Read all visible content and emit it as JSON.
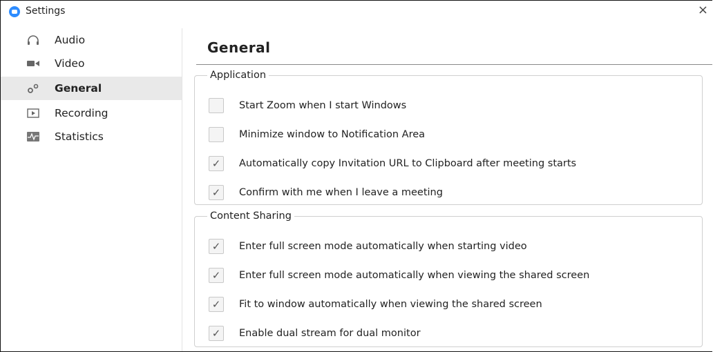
{
  "window": {
    "title": "Settings",
    "close_glyph": "×"
  },
  "sidebar": {
    "items": [
      {
        "label": "Audio",
        "icon": "headphones-icon",
        "active": false
      },
      {
        "label": "Video",
        "icon": "video-camera-icon",
        "active": false
      },
      {
        "label": "General",
        "icon": "gears-icon",
        "active": true
      },
      {
        "label": "Recording",
        "icon": "recording-icon",
        "active": false
      },
      {
        "label": "Statistics",
        "icon": "statistics-icon",
        "active": false
      }
    ]
  },
  "main": {
    "heading": "General",
    "groups": [
      {
        "legend": "Application",
        "options": [
          {
            "label": "Start Zoom when I start Windows",
            "checked": false
          },
          {
            "label": "Minimize window to Notification Area",
            "checked": false
          },
          {
            "label": "Automatically copy Invitation URL to Clipboard after meeting starts",
            "checked": true
          },
          {
            "label": "Confirm with me when I leave a meeting",
            "checked": true
          }
        ]
      },
      {
        "legend": "Content Sharing",
        "options": [
          {
            "label": "Enter full screen mode automatically when starting video",
            "checked": true
          },
          {
            "label": "Enter full screen mode automatically when viewing the shared screen",
            "checked": true
          },
          {
            "label": "Fit to window automatically when viewing the shared screen",
            "checked": true
          },
          {
            "label": "Enable dual stream for dual monitor",
            "checked": true
          }
        ]
      }
    ]
  },
  "colors": {
    "accent": "#2d8cff",
    "active_bg": "#e9e9e9",
    "border": "#cfcfcf"
  },
  "checkmark": "✓"
}
